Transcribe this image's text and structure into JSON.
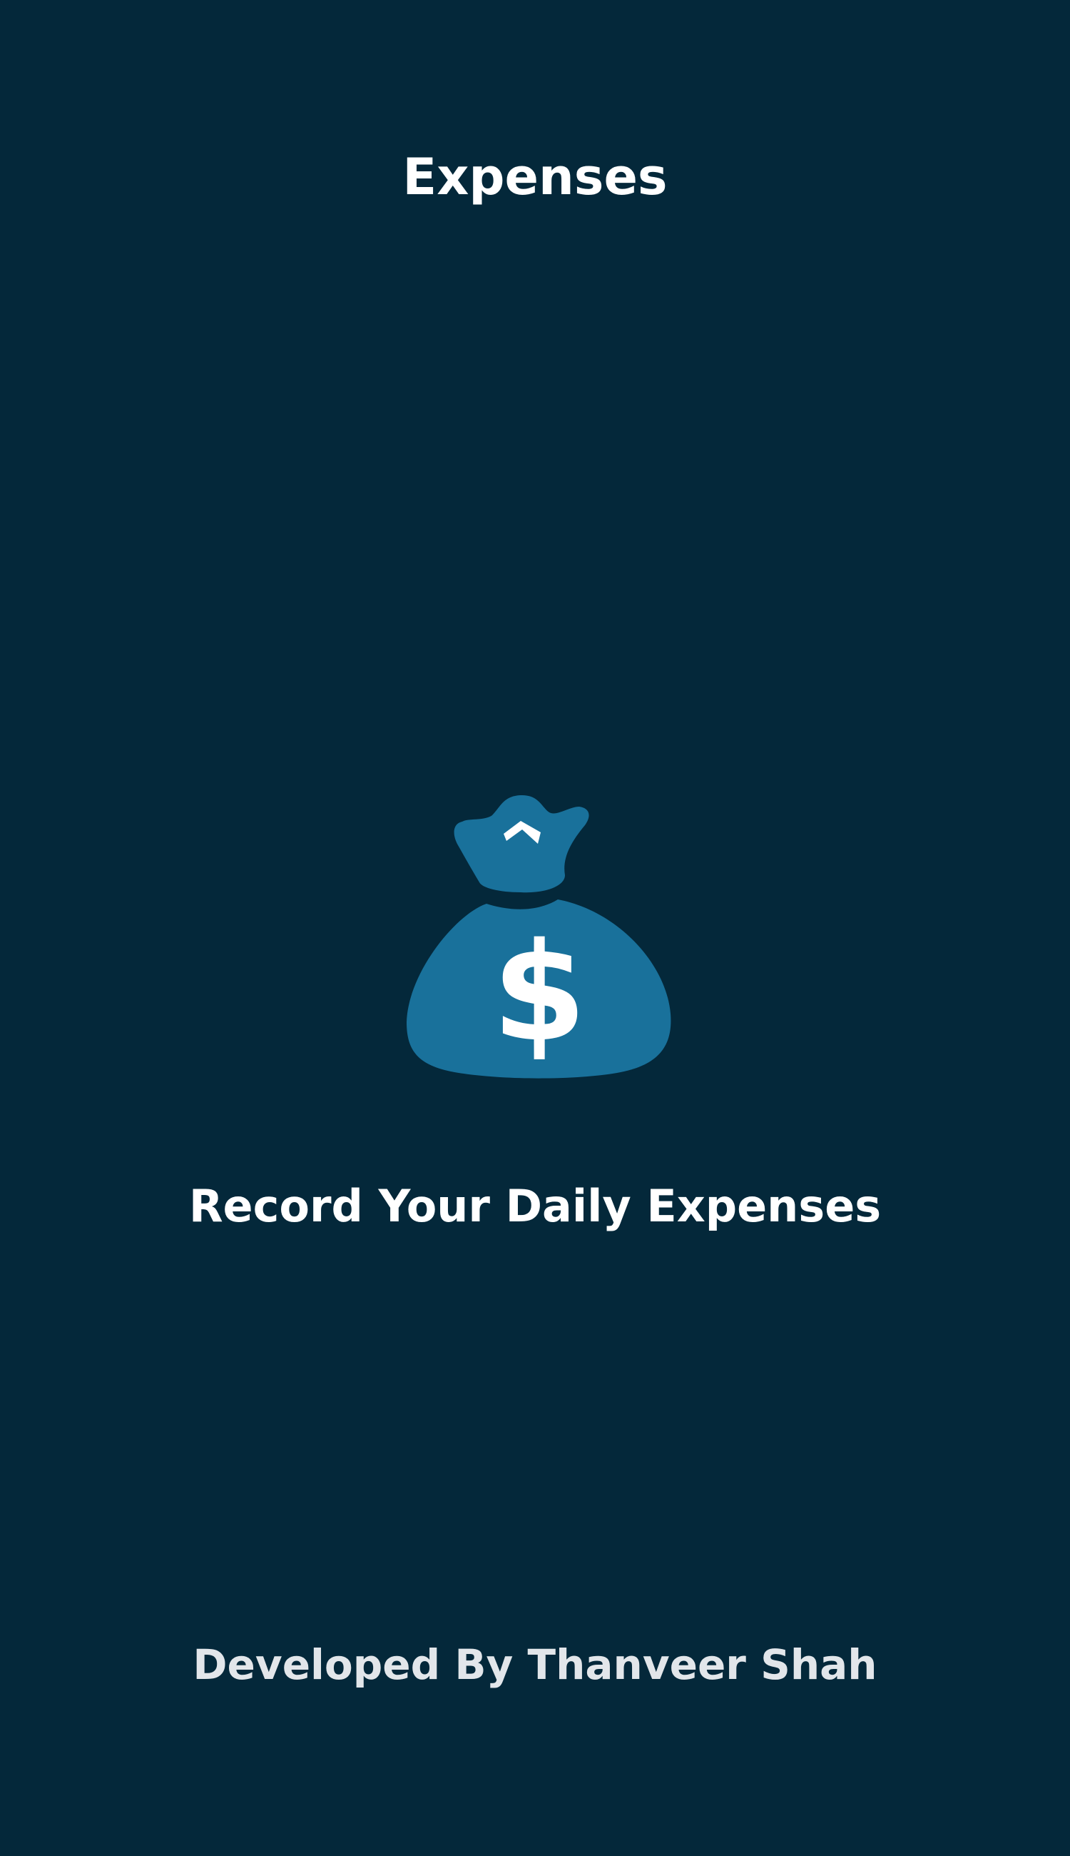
{
  "app": {
    "title": "Expenses",
    "tagline": "Record Your Daily Expenses",
    "credit": "Developed By Thanveer Shah"
  },
  "logo": {
    "icon": "money-bag-icon",
    "symbol": "$"
  },
  "colors": {
    "background": "#04283A",
    "accent": "#19719B",
    "text": "#FFFFFF",
    "credit_text": "#E2E6EA"
  }
}
